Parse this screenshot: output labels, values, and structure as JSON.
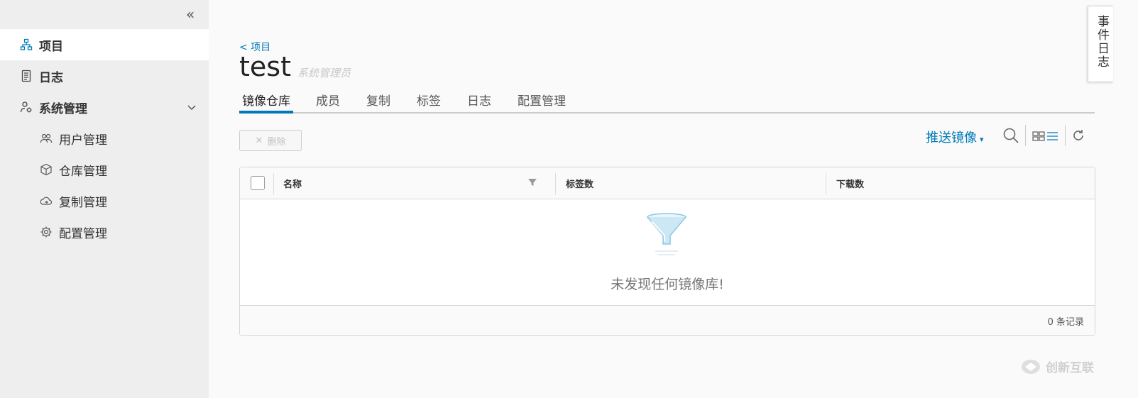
{
  "sidebar": {
    "items": [
      {
        "label": "项目",
        "icon": "project-tree-icon"
      },
      {
        "label": "日志",
        "icon": "log-document-icon"
      },
      {
        "label": "系统管理",
        "icon": "admin-users-gear-icon"
      }
    ],
    "sub_items": [
      {
        "label": "用户管理",
        "icon": "users-icon"
      },
      {
        "label": "仓库管理",
        "icon": "cube-icon"
      },
      {
        "label": "复制管理",
        "icon": "cloud-sync-icon"
      },
      {
        "label": "配置管理",
        "icon": "gear-icon"
      }
    ]
  },
  "header": {
    "breadcrumb": "< 项目",
    "title": "test",
    "role": "系统管理员"
  },
  "tabs": [
    {
      "label": "镜像仓库"
    },
    {
      "label": "成员"
    },
    {
      "label": "复制"
    },
    {
      "label": "标签"
    },
    {
      "label": "日志"
    },
    {
      "label": "配置管理"
    }
  ],
  "toolbar": {
    "delete_label": "删除",
    "push_label": "推送镜像"
  },
  "table": {
    "columns": [
      "名称",
      "标签数",
      "下载数"
    ],
    "empty_text": "未发现任何镜像库!",
    "count_text": "0 条记录"
  },
  "event_panel": {
    "label": "事件日志"
  },
  "watermark": {
    "text": "创新互联"
  },
  "colors": {
    "accent": "#0079b8",
    "sidebar_bg": "#eeeeee"
  }
}
